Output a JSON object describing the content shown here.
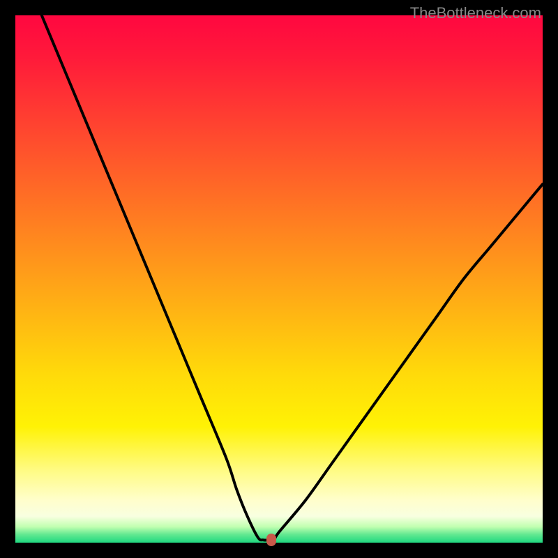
{
  "watermark": "TheBottleneck.com",
  "chart_data": {
    "type": "line",
    "title": "",
    "xlabel": "",
    "ylabel": "",
    "xlim": [
      0,
      100
    ],
    "ylim": [
      0,
      100
    ],
    "series": [
      {
        "name": "bottleneck-curve",
        "x": [
          5,
          10,
          15,
          20,
          25,
          30,
          35,
          40,
          42,
          44,
          46,
          47,
          48,
          49,
          50,
          55,
          60,
          65,
          70,
          75,
          80,
          85,
          90,
          95,
          100
        ],
        "values": [
          100,
          88,
          76,
          64,
          52,
          40,
          28,
          16,
          10,
          5,
          1,
          0.5,
          0.5,
          0.5,
          2,
          8,
          15,
          22,
          29,
          36,
          43,
          50,
          56,
          62,
          68
        ]
      }
    ],
    "marker": {
      "x": 48.5,
      "y": 0.5,
      "color": "#c85a4a"
    },
    "gradient_stops": [
      {
        "pos": 0,
        "color": "#ff0740"
      },
      {
        "pos": 50,
        "color": "#ffba12"
      },
      {
        "pos": 80,
        "color": "#fff205"
      },
      {
        "pos": 97,
        "color": "#c0ffb0"
      },
      {
        "pos": 100,
        "color": "#20d880"
      }
    ]
  }
}
